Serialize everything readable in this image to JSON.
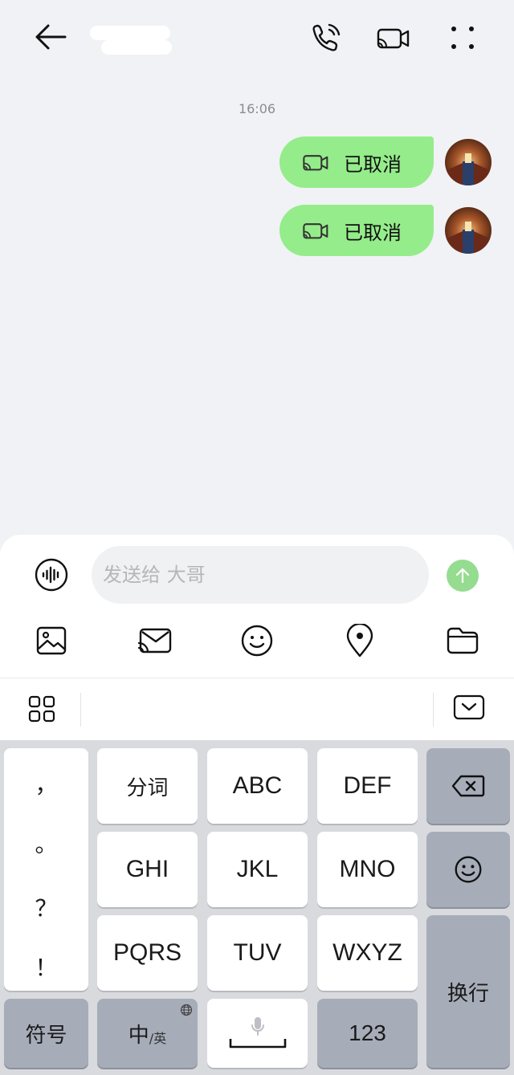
{
  "header": {
    "contact_name": "",
    "icons": [
      "back-arrow-icon",
      "phone-icon",
      "video-call-icon",
      "more-icon"
    ]
  },
  "chat": {
    "timestamp": "16:06",
    "messages": [
      {
        "icon": "video-call-icon",
        "text": "已取消",
        "from": "me"
      },
      {
        "icon": "video-call-icon",
        "text": "已取消",
        "from": "me"
      }
    ]
  },
  "composer": {
    "placeholder": "发送给 大哥",
    "tools": [
      "image-icon",
      "video-message-icon",
      "emoji-icon",
      "location-icon",
      "folder-icon"
    ]
  },
  "keyboard": {
    "punctuation": [
      "，",
      "。",
      "？",
      "！"
    ],
    "row1": [
      "分词",
      "ABC",
      "DEF"
    ],
    "row2": [
      "GHI",
      "JKL",
      "MNO"
    ],
    "row3": [
      "PQRS",
      "TUV",
      "WXYZ"
    ],
    "symbols_label": "符号",
    "lang_main": "中",
    "lang_alt": "/英",
    "numbers_label": "123",
    "enter_label": "换行"
  },
  "colors": {
    "bubble": "#95ec8a",
    "background": "#f1f2f5",
    "send_button": "#95dc90",
    "keyboard_dark_key": "#a7acb9"
  }
}
